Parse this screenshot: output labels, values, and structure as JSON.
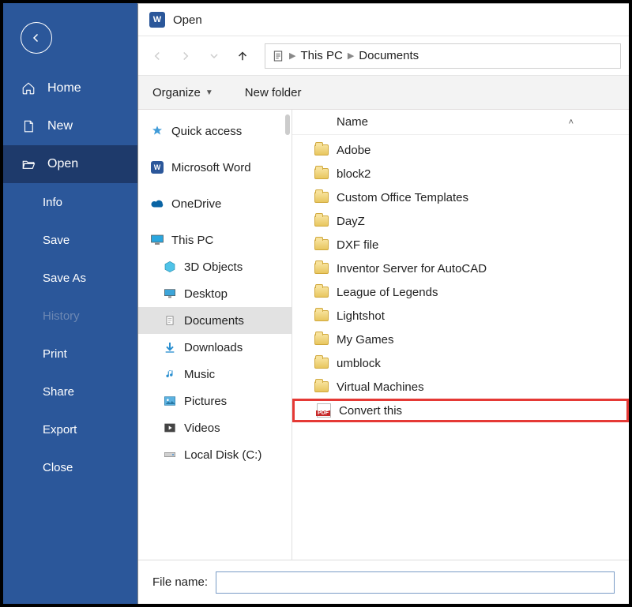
{
  "word_menu": {
    "home": "Home",
    "new": "New",
    "open": "Open",
    "info": "Info",
    "save": "Save",
    "save_as": "Save As",
    "history": "History",
    "print": "Print",
    "share": "Share",
    "export": "Export",
    "close": "Close"
  },
  "dialog": {
    "title": "Open",
    "toolbar": {
      "organize": "Organize",
      "new_folder": "New folder"
    },
    "breadcrumb": {
      "root": "This PC",
      "current": "Documents"
    },
    "list_header": {
      "name": "Name"
    },
    "filename_label": "File name:",
    "filename_value": ""
  },
  "tree": {
    "quick_access": "Quick access",
    "word": "Microsoft Word",
    "onedrive": "OneDrive",
    "this_pc": "This PC",
    "objects3d": "3D Objects",
    "desktop": "Desktop",
    "documents": "Documents",
    "downloads": "Downloads",
    "music": "Music",
    "pictures": "Pictures",
    "videos": "Videos",
    "localdisk": "Local Disk (C:)"
  },
  "files": [
    {
      "name": "Adobe",
      "type": "folder"
    },
    {
      "name": "block2",
      "type": "folder"
    },
    {
      "name": "Custom Office Templates",
      "type": "folder"
    },
    {
      "name": "DayZ",
      "type": "folder"
    },
    {
      "name": "DXF file",
      "type": "folder"
    },
    {
      "name": "Inventor Server for AutoCAD",
      "type": "folder"
    },
    {
      "name": "League of Legends",
      "type": "folder"
    },
    {
      "name": "Lightshot",
      "type": "folder"
    },
    {
      "name": "My Games",
      "type": "folder"
    },
    {
      "name": "umblock",
      "type": "folder"
    },
    {
      "name": "Virtual Machines",
      "type": "folder"
    },
    {
      "name": "Convert this",
      "type": "pdf",
      "highlight": true
    }
  ]
}
